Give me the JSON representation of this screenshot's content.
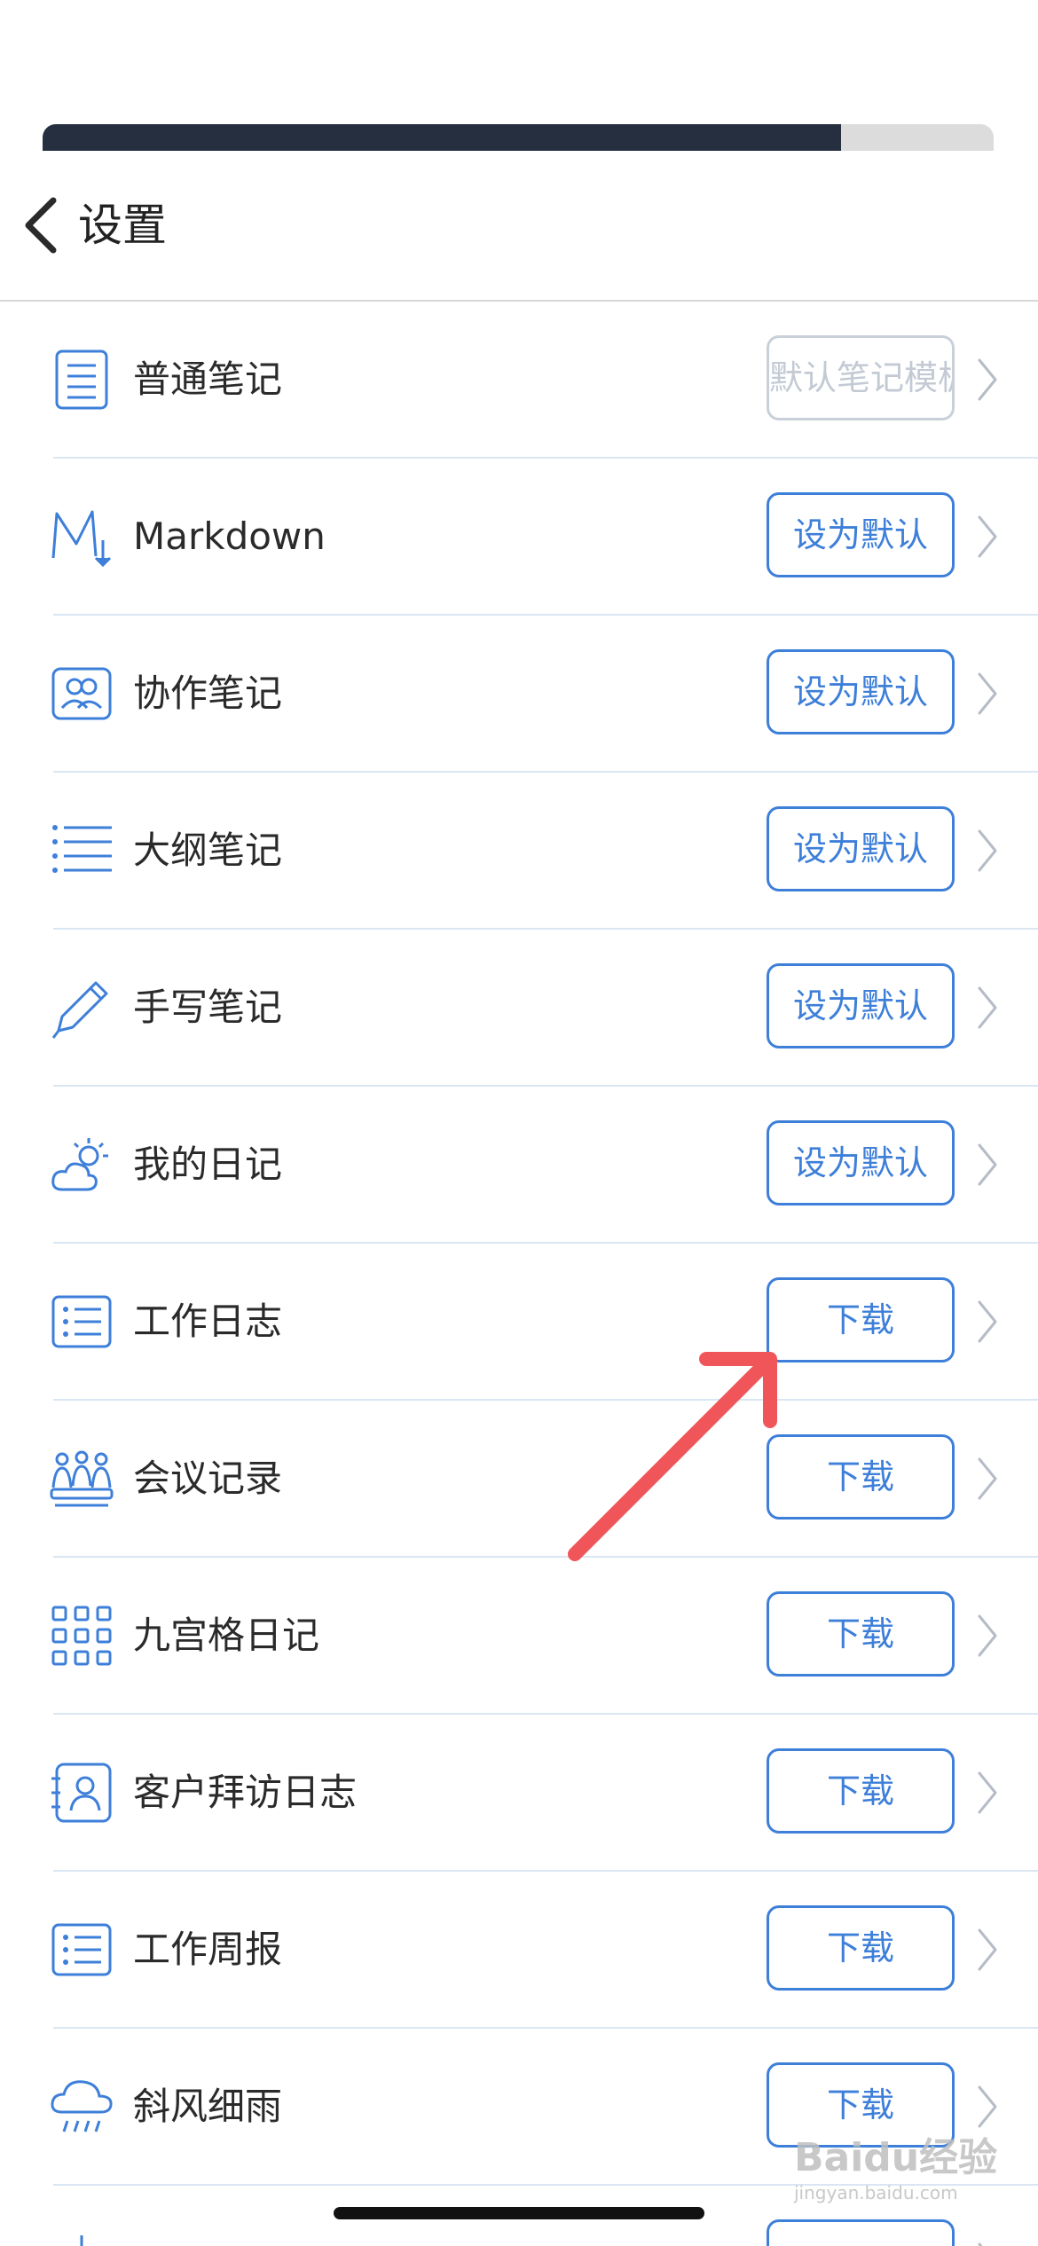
{
  "status": {
    "progress_fraction": 0.84
  },
  "nav": {
    "title": "设置"
  },
  "colors": {
    "accent": "#3d7fd9",
    "disabled": "#c3cad4",
    "divider": "#d9e6f3",
    "annotation": "#f0555a"
  },
  "templates": [
    {
      "icon": "document-lines-icon",
      "label": "普通笔记",
      "button": "默认笔记模板",
      "button_state": "disabled"
    },
    {
      "icon": "markdown-icon",
      "label": "Markdown",
      "button": "设为默认",
      "button_state": "active"
    },
    {
      "icon": "collaboration-icon",
      "label": "协作笔记",
      "button": "设为默认",
      "button_state": "active"
    },
    {
      "icon": "outline-list-icon",
      "label": "大纲笔记",
      "button": "设为默认",
      "button_state": "active"
    },
    {
      "icon": "pen-icon",
      "label": "手写笔记",
      "button": "设为默认",
      "button_state": "active"
    },
    {
      "icon": "weather-cloud-sun-icon",
      "label": "我的日记",
      "button": "设为默认",
      "button_state": "active"
    },
    {
      "icon": "list-box-icon",
      "label": "工作日志",
      "button": "下载",
      "button_state": "active"
    },
    {
      "icon": "meeting-people-icon",
      "label": "会议记录",
      "button": "下载",
      "button_state": "active"
    },
    {
      "icon": "grid-nine-icon",
      "label": "九宫格日记",
      "button": "下载",
      "button_state": "active"
    },
    {
      "icon": "contact-card-icon",
      "label": "客户拜访日志",
      "button": "下载",
      "button_state": "active"
    },
    {
      "icon": "list-box-icon",
      "label": "工作周报",
      "button": "下载",
      "button_state": "active"
    },
    {
      "icon": "rain-cloud-icon",
      "label": "斜风细雨",
      "button": "下载",
      "button_state": "active"
    },
    {
      "icon": "snowflake-icon",
      "label": "",
      "button": "",
      "button_state": "active"
    }
  ],
  "watermark": {
    "text": "Baidu经验",
    "subtext": "jingyan.baidu.com"
  }
}
